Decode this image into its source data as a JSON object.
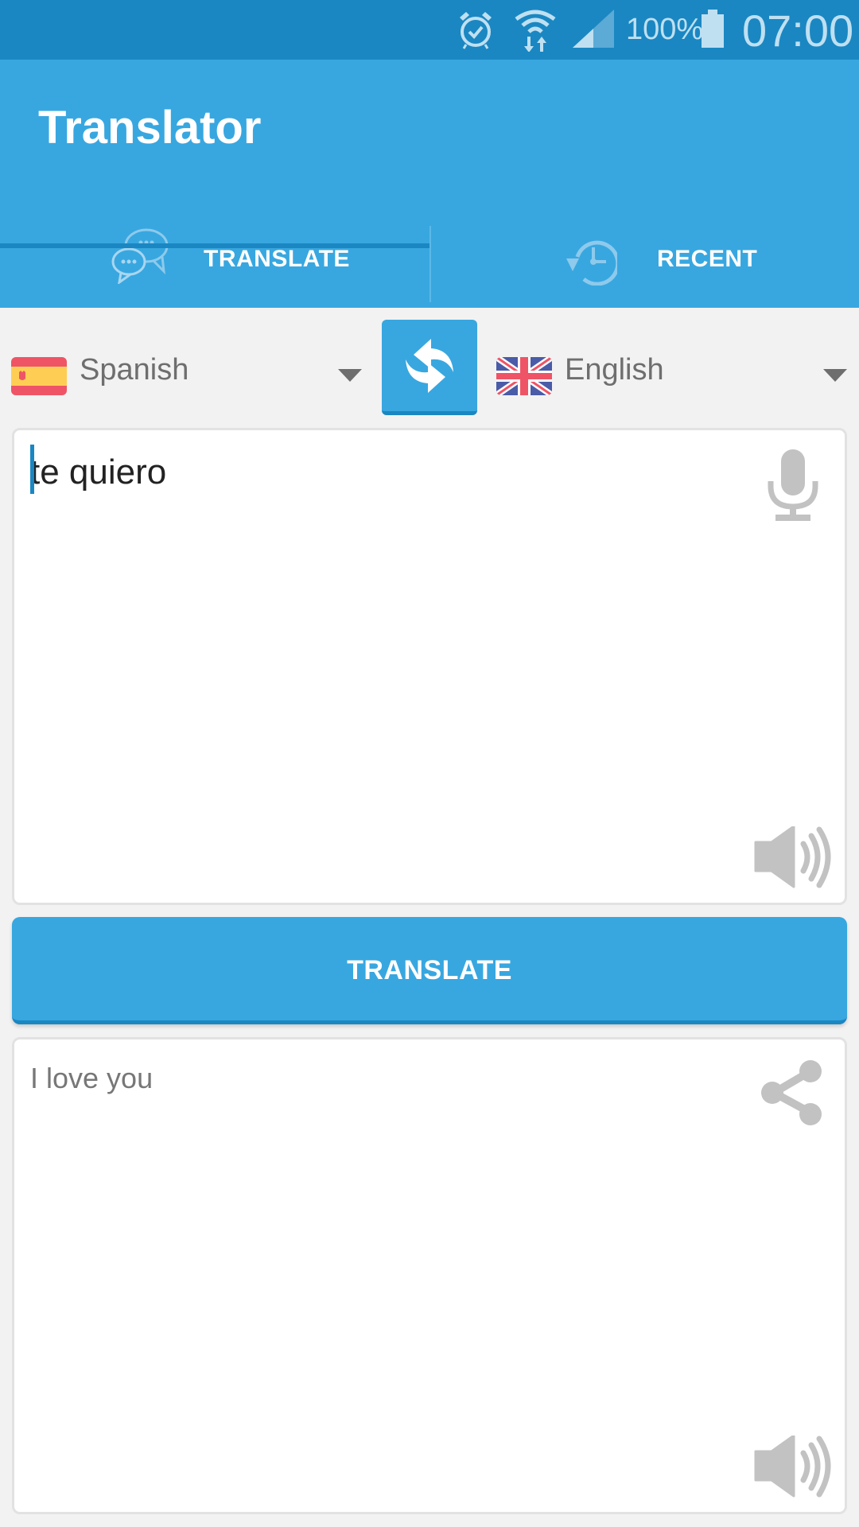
{
  "status_bar": {
    "icons": [
      "alarm-icon",
      "wifi-icon",
      "signal-icon",
      "battery-icon"
    ],
    "battery_pct": "100%",
    "time": "07:00"
  },
  "app_bar": {
    "title": "Translator"
  },
  "tabs": [
    {
      "label": "TRANSLATE",
      "icon": "chat-bubbles-icon",
      "active": true
    },
    {
      "label": "RECENT",
      "icon": "history-icon",
      "active": false
    }
  ],
  "languages": {
    "from": {
      "name": "Spanish",
      "flag": "spain-flag"
    },
    "to": {
      "name": "English",
      "flag": "uk-flag"
    },
    "swap_icon": "swap-icon"
  },
  "input": {
    "value": "te quiero",
    "icons": [
      "microphone-icon",
      "speaker-icon"
    ]
  },
  "translate_button": {
    "label": "TRANSLATE"
  },
  "output": {
    "text": "I love you",
    "icons": [
      "share-icon",
      "speaker-icon"
    ]
  },
  "colors": {
    "status_bar": "#1a87c2",
    "app_bar": "#38a7e0",
    "accent_dark": "#1a87c2",
    "background": "#f2f2f2",
    "icon_gray": "#c2c2c2",
    "text_secondary": "#6e6e6e"
  }
}
